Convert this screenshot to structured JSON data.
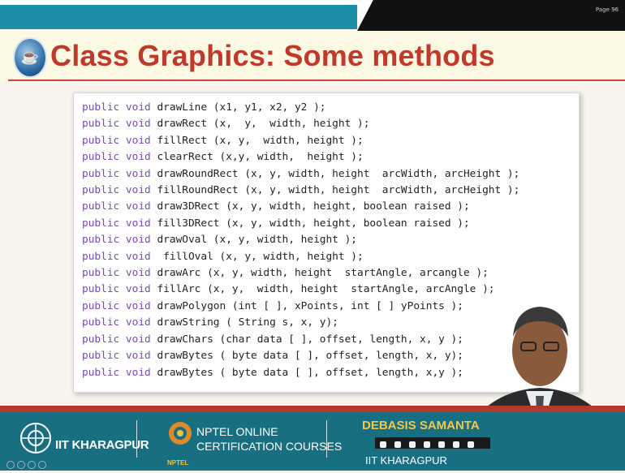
{
  "header": {
    "page_number": "Page 96"
  },
  "title": {
    "logo_icon": "java-logo-icon",
    "text": "Class Graphics: Some methods"
  },
  "code_lines": [
    {
      "kw": "public void",
      "text": " drawLine (x1, y1, x2, y2 );"
    },
    {
      "kw": "public void",
      "text": " drawRect (x,  y,  width, height );"
    },
    {
      "kw": "public void",
      "text": " fillRect (x, y,  width, height );"
    },
    {
      "kw": "public void",
      "text": " clearRect (x,y, width,  height );"
    },
    {
      "kw": "public void",
      "text": " drawRoundRect (x, y, width, height  arcWidth, arcHeight );"
    },
    {
      "kw": "public void",
      "text": " fillRoundRect (x, y, width, height  arcWidth, arcHeight );"
    },
    {
      "kw": "public void",
      "text": " draw3DRect (x, y, width, height, boolean raised );"
    },
    {
      "kw": "public void",
      "text": " fill3DRect (x, y, width, height, boolean raised );"
    },
    {
      "kw": "public void",
      "text": " drawOval (x, y, width, height );"
    },
    {
      "kw": "public void",
      "text": "  fillOval (x, y, width, height );"
    },
    {
      "kw": "public void",
      "text": " drawArc (x, y, width, height  startAngle, arcangle );"
    },
    {
      "kw": "public void",
      "text": " fillArc (x, y,  width, height  startAngle, arcAngle );"
    },
    {
      "kw": "public void",
      "text": " drawPolygon (int [ ], xPoints, int [ ] yPoints );"
    },
    {
      "kw": "public void",
      "text": " drawString ( String s, x, y);"
    },
    {
      "kw": "public void",
      "text": " drawChars (char data [ ], offset, length, x, y );"
    },
    {
      "kw": "public void",
      "text": " drawBytes ( byte data [ ], offset, length, x, y);"
    },
    {
      "kw": "public void",
      "text": " drawBytes ( byte data [ ], offset, length, x,y );"
    }
  ],
  "footer": {
    "institute": "IIT KHARAGPUR",
    "nptel_line1": "NPTEL ONLINE",
    "nptel_line2": "CERTIFICATION COURSES",
    "nptel_logo_text": "NPTEL",
    "presenter_name": "DEBASIS SAMANTA",
    "presenter_institute": "IIT KHARAGPUR"
  },
  "colors": {
    "title": "#c0392b",
    "header_teal": "#1b8fa6",
    "footer_teal": "#196f82",
    "keyword": "#7a4bb5"
  }
}
